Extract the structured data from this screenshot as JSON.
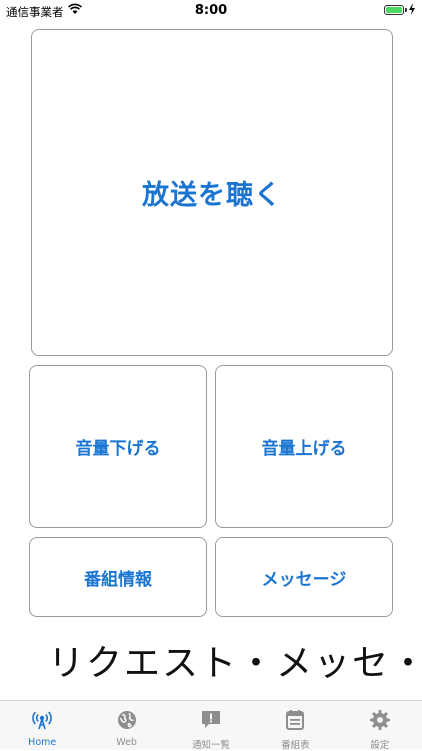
{
  "status_bar": {
    "carrier": "通信事業者",
    "time": "8:00"
  },
  "main": {
    "listen_label": "放送を聴く",
    "volume_down_label": "音量下げる",
    "volume_up_label": "音量上げる",
    "program_info_label": "番組情報",
    "message_label": "メッセージ"
  },
  "ticker": {
    "text": "リクエスト・メッセ・"
  },
  "tabbar": {
    "tabs": [
      {
        "label": "Home",
        "icon": "antenna-icon",
        "active": true
      },
      {
        "label": "Web",
        "icon": "globe-icon",
        "active": false
      },
      {
        "label": "通知一覧",
        "icon": "notification-icon",
        "active": false
      },
      {
        "label": "番組表",
        "icon": "schedule-icon",
        "active": false
      },
      {
        "label": "設定",
        "icon": "gear-icon",
        "active": false
      }
    ]
  },
  "colors": {
    "accent": "#1a75d2",
    "inactive": "#8e8e8e",
    "battery": "#4cd964"
  }
}
